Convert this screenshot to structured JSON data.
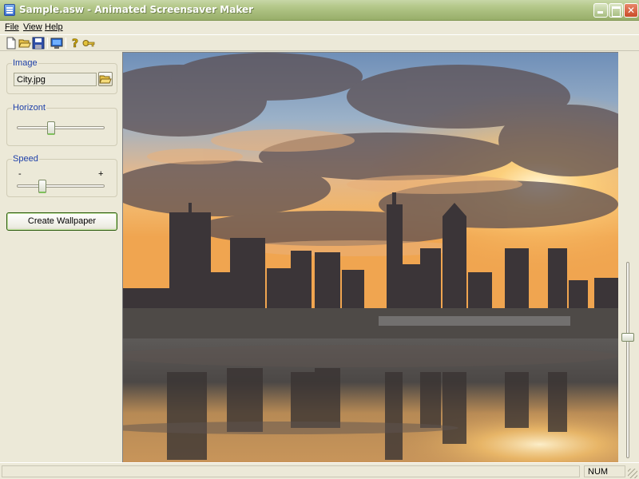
{
  "window": {
    "title": "Sample.asw - Animated Screensaver Maker",
    "controls": [
      "minimize-icon",
      "maximize-icon",
      "close-icon"
    ]
  },
  "menu": {
    "file": "File",
    "view": "View",
    "help": "Help"
  },
  "toolbar": {
    "icons": [
      "new-document-icon",
      "open-folder-icon",
      "save-icon",
      "monitor-preview-icon",
      "help-icon",
      "key-icon"
    ]
  },
  "panel": {
    "image": {
      "label": "Image",
      "filename": "City.jpg"
    },
    "horizont": {
      "label": "Horizont",
      "value": 0.38
    },
    "speed": {
      "label": "Speed",
      "minus": "-",
      "plus": "+",
      "value": 0.27
    },
    "create_button": "Create Wallpaper"
  },
  "preview": {
    "vertical_slider_value": 0.37
  },
  "status": {
    "num": "NUM"
  },
  "colors": {
    "group_title": "#1d3fa8",
    "titlebar": "#a8bd7c",
    "button_border": "#2a5a0d"
  }
}
